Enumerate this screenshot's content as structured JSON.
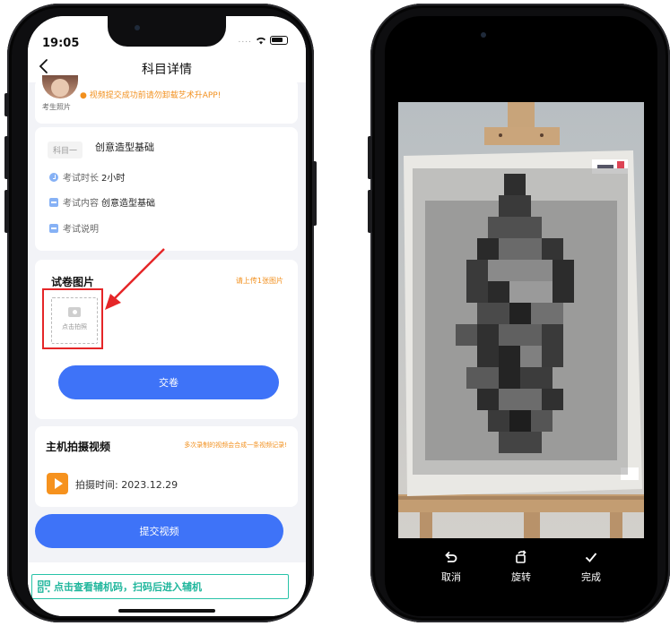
{
  "left_phone": {
    "status_bar": {
      "time": "19:05",
      "signal": "....",
      "wifi_icon": "wifi-icon",
      "battery_icon": "battery-icon"
    },
    "nav": {
      "title": "科目详情",
      "back_icon": "chevron-left-icon"
    },
    "photo_card": {
      "warning": "● 视频提交成功前请勿卸载艺术升APP!",
      "caption": "考生照片"
    },
    "subject": {
      "tag": "科目一",
      "name": "创意造型基础",
      "duration_label": "考试时长",
      "duration_value": "2小时",
      "content_label": "考试内容",
      "content_value": "创意造型基础",
      "instructions_label": "考试说明"
    },
    "paper": {
      "title": "试卷图片",
      "hint": "请上传1张图片",
      "upload_label": "点击拍照",
      "submit_label": "交卷"
    },
    "video": {
      "title": "主机拍摄视频",
      "hint": "多次录制的视频会合成一条视频记录!",
      "time_label": "拍摄时间: 2023.12.29",
      "submit_label": "提交视频"
    },
    "qr_banner": {
      "text": "点击查看辅机码，扫码后进入辅机"
    },
    "colors": {
      "primary": "#3e73f8",
      "warning": "#f2901e",
      "accent_green": "#1fb69c",
      "highlight_red": "#e52628"
    }
  },
  "right_phone": {
    "toolbar": {
      "cancel_label": "取消",
      "rotate_label": "旋转",
      "done_label": "完成"
    }
  }
}
